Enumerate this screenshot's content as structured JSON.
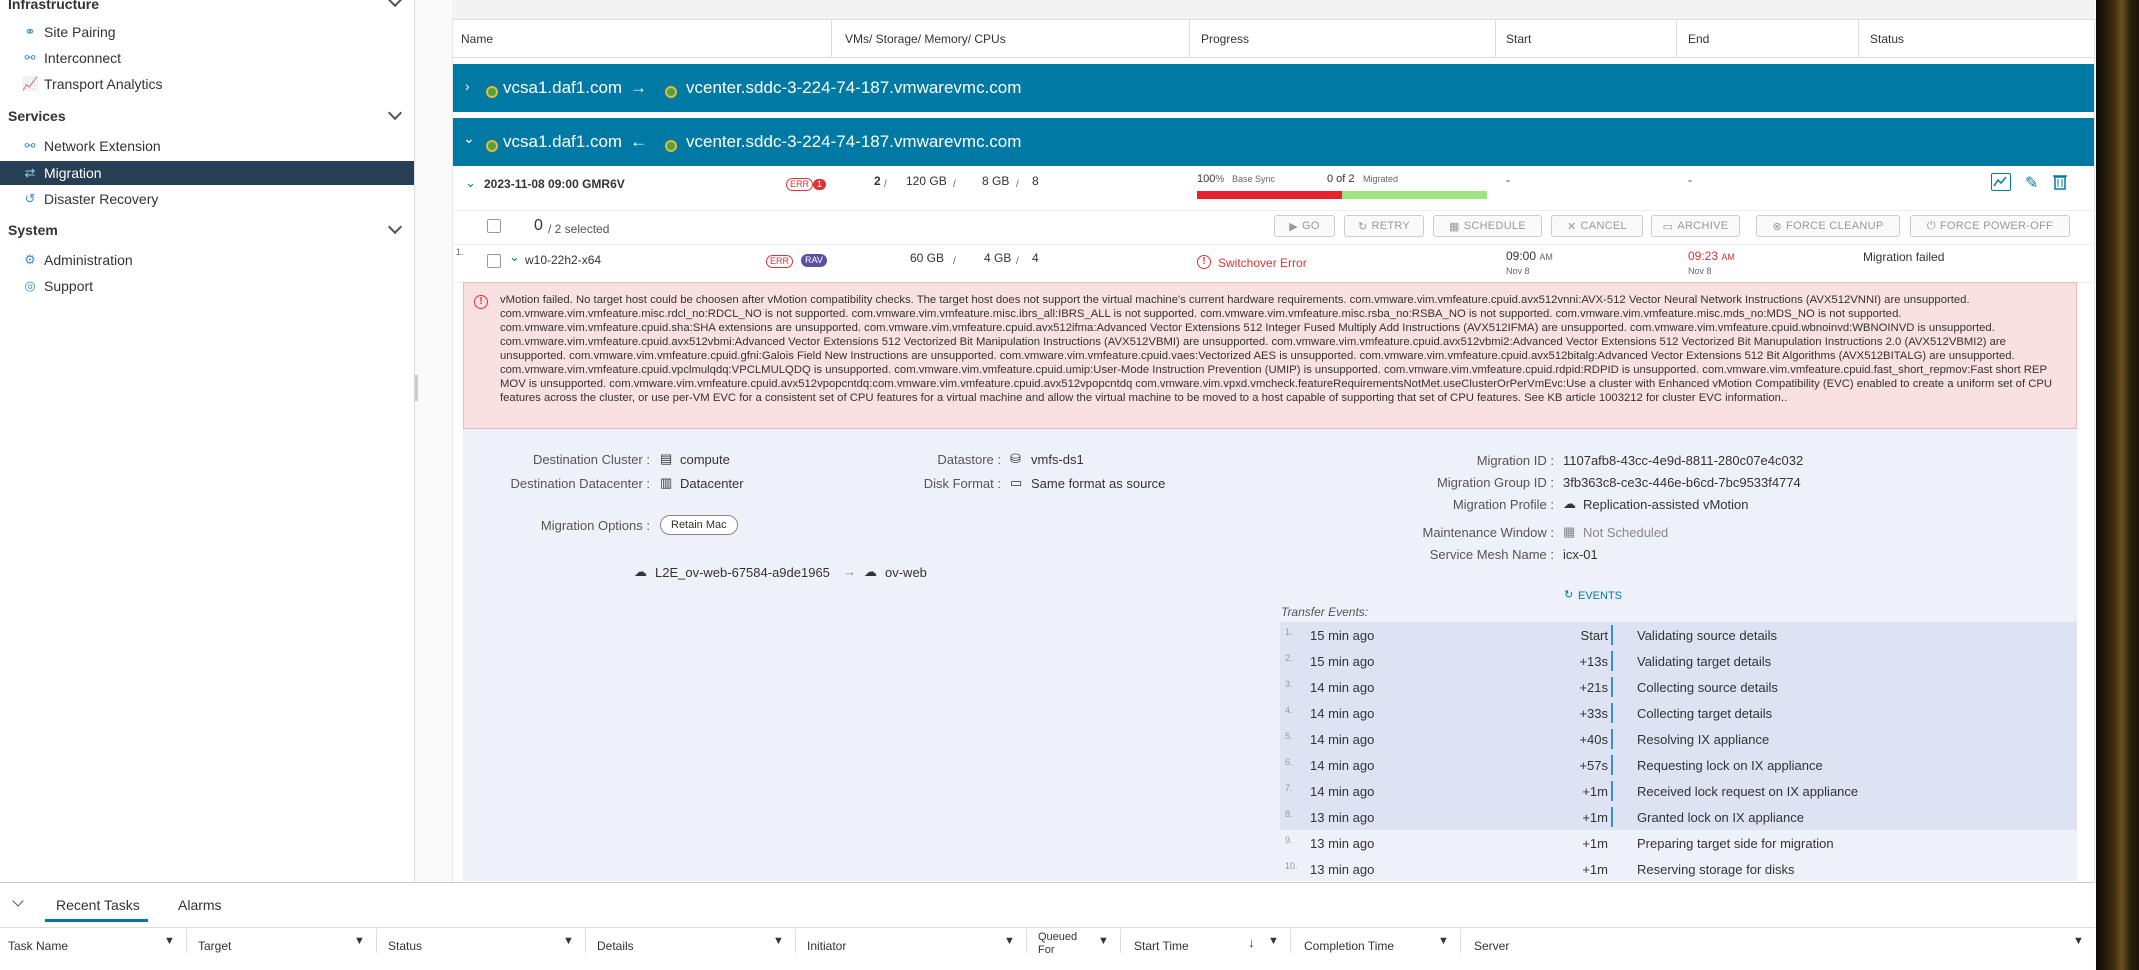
{
  "sidebar": {
    "sections": [
      {
        "title": "Infrastructure",
        "items": [
          {
            "label": "Site Pairing",
            "icon": "site-pairing-icon"
          },
          {
            "label": "Interconnect",
            "icon": "interconnect-icon"
          },
          {
            "label": "Transport Analytics",
            "icon": "analytics-icon"
          }
        ]
      },
      {
        "title": "Services",
        "items": [
          {
            "label": "Network Extension",
            "icon": "network-extension-icon"
          },
          {
            "label": "Migration",
            "icon": "migration-icon"
          },
          {
            "label": "Disaster Recovery",
            "icon": "disaster-recovery-icon"
          }
        ]
      },
      {
        "title": "System",
        "items": [
          {
            "label": "Administration",
            "icon": "administration-icon"
          },
          {
            "label": "Support",
            "icon": "support-icon"
          }
        ]
      }
    ]
  },
  "table": {
    "headers": [
      "Name",
      "VMs/ Storage/ Memory/ CPUs",
      "Progress",
      "Start",
      "End",
      "Status"
    ]
  },
  "pairs": [
    {
      "source": "vcsa1.daf1.com",
      "target": "vcenter.sddc-3-224-74-187.vmwarevmc.com",
      "expanded": false
    },
    {
      "source": "vcsa1.daf1.com",
      "target": "vcenter.sddc-3-224-74-187.vmwarevmc.com",
      "expanded": true
    }
  ],
  "group": {
    "name": "2023-11-08 09:00 GMR6V",
    "err": "ERR",
    "err_count": "1",
    "vms": "2",
    "storage": "120 GB",
    "memory": "8 GB",
    "cpus": "8",
    "progress_pct": "100",
    "progress_unit": "%",
    "progress_label": "Base Sync",
    "migrated_count": "0 of 2",
    "migrated_label": "Migrated",
    "start": "-",
    "end": "-"
  },
  "toolbar": {
    "selected_count": "0",
    "selected_text": "/ 2 selected",
    "go": "GO",
    "retry": "RETRY",
    "schedule": "SCHEDULE",
    "cancel": "CANCEL",
    "archive": "ARCHIVE",
    "force_cleanup": "FORCE CLEANUP",
    "force_poweroff": "FORCE POWER-OFF"
  },
  "vm": {
    "index": "1.",
    "name": "w10-22h2-x64",
    "err": "ERR",
    "rav": "RAV",
    "storage": "60 GB",
    "memory": "4 GB",
    "cpus": "4",
    "error_label": "Switchover Error",
    "start_time": "09:00",
    "start_ampm": "AM",
    "start_date": "Nov 8",
    "end_time": "09:23",
    "end_ampm": "AM",
    "end_date": "Nov 8",
    "status": "Migration failed"
  },
  "error_message": "vMotion failed. No target host could be choosen after vMotion compatibility checks. The target host does not support the virtual machine's current hardware requirements. com.vmware.vim.vmfeature.cpuid.avx512vnni:AVX-512 Vector Neural Network Instructions (AVX512VNNI) are unsupported. com.vmware.vim.vmfeature.misc.rdcl_no:RDCL_NO is not supported. com.vmware.vim.vmfeature.misc.ibrs_all:IBRS_ALL is not supported. com.vmware.vim.vmfeature.misc.rsba_no:RSBA_NO is not supported. com.vmware.vim.vmfeature.misc.mds_no:MDS_NO is not supported. com.vmware.vim.vmfeature.cpuid.sha:SHA extensions are unsupported. com.vmware.vim.vmfeature.cpuid.avx512ifma:Advanced Vector Extensions 512 Integer Fused Multiply Add Instructions (AVX512IFMA) are unsupported. com.vmware.vim.vmfeature.cpuid.wbnoinvd:WBNOINVD is unsupported. com.vmware.vim.vmfeature.cpuid.avx512vbmi:Advanced Vector Extensions 512 Vectorized Bit Manipulation Instructions (AVX512VBMI) are unsupported. com.vmware.vim.vmfeature.cpuid.avx512vbmi2:Advanced Vector Extensions 512 Vectorized Bit Manupulation Instructions 2.0 (AVX512VBMI2) are unsupported. com.vmware.vim.vmfeature.cpuid.gfni:Galois Field New Instructions are unsupported. com.vmware.vim.vmfeature.cpuid.vaes:Vectorized AES is unsupported. com.vmware.vim.vmfeature.cpuid.avx512bitalg:Advanced Vector Extensions 512 Bit Algorithms (AVX512BITALG) are unsupported. com.vmware.vim.vmfeature.cpuid.vpclmulqdq:VPCLMULQDQ is unsupported. com.vmware.vim.vmfeature.cpuid.umip:User-Mode Instruction Prevention (UMIP) is unsupported. com.vmware.vim.vmfeature.cpuid.rdpid:RDPID is unsupported. com.vmware.vim.vmfeature.cpuid.fast_short_repmov:Fast short REP MOV is unsupported. com.vmware.vim.vmfeature.cpuid.avx512vpopcntdq:com.vmware.vim.vmfeature.cpuid.avx512vpopcntdq com.vmware.vim.vpxd.vmcheck.featureRequirementsNotMet.useClusterOrPerVmEvc:Use a cluster with Enhanced vMotion Compatibility (EVC) enabled to create a uniform set of CPU features across the cluster, or use per-VM EVC for a consistent set of CPU features for a virtual machine and allow the virtual machine to be moved to a host capable of supporting that set of CPU features. See KB article 1003212 for cluster EVC information..",
  "details": {
    "dest_cluster_label": "Destination Cluster :",
    "dest_cluster": "compute",
    "dest_dc_label": "Destination Datacenter :",
    "dest_dc": "Datacenter",
    "datastore_label": "Datastore :",
    "datastore": "vmfs-ds1",
    "disk_format_label": "Disk Format :",
    "disk_format": "Same format as source",
    "migration_options_label": "Migration Options :",
    "retain_mac": "Retain Mac",
    "network_source": "L2E_ov-web-67584-a9de1965",
    "network_target": "ov-web",
    "migration_id_label": "Migration ID :",
    "migration_id": "1107afb8-43cc-4e9d-8811-280c07e4c032",
    "migration_group_id_label": "Migration Group ID :",
    "migration_group_id": "3fb363c8-ce3c-446e-b6cd-7bc9533f4774",
    "migration_profile_label": "Migration Profile :",
    "migration_profile": "Replication-assisted vMotion",
    "maintenance_window_label": "Maintenance Window :",
    "maintenance_window": "Not Scheduled",
    "service_mesh_label": "Service Mesh Name :",
    "service_mesh": "icx-01",
    "events_link": "EVENTS",
    "transfer_events_label": "Transfer Events:"
  },
  "events": [
    {
      "n": "1.",
      "ago": "15 min ago",
      "delta": "Start",
      "text": "Validating source details"
    },
    {
      "n": "2.",
      "ago": "15 min ago",
      "delta": "+13s",
      "text": "Validating target details"
    },
    {
      "n": "3.",
      "ago": "14 min ago",
      "delta": "+21s",
      "text": "Collecting source details"
    },
    {
      "n": "4.",
      "ago": "14 min ago",
      "delta": "+33s",
      "text": "Collecting target details"
    },
    {
      "n": "5.",
      "ago": "14 min ago",
      "delta": "+40s",
      "text": "Resolving IX appliance"
    },
    {
      "n": "6.",
      "ago": "14 min ago",
      "delta": "+57s",
      "text": "Requesting lock on IX appliance"
    },
    {
      "n": "7.",
      "ago": "14 min ago",
      "delta": "+1m",
      "text": "Received lock request on IX appliance"
    },
    {
      "n": "8.",
      "ago": "13 min ago",
      "delta": "+1m",
      "text": "Granted lock on IX appliance"
    },
    {
      "n": "9.",
      "ago": "13 min ago",
      "delta": "+1m",
      "text": "Preparing target side for migration"
    },
    {
      "n": "10.",
      "ago": "13 min ago",
      "delta": "+1m",
      "text": "Reserving storage for disks"
    }
  ],
  "bottom": {
    "tabs": [
      "Recent Tasks",
      "Alarms"
    ],
    "columns": [
      "Task Name",
      "Target",
      "Status",
      "Details",
      "Initiator",
      "Queued For",
      "Start Time",
      "Completion Time",
      "Server"
    ]
  },
  "colors": {
    "pair_bar": "#0079a4",
    "active_nav": "#263f54",
    "error_bg": "#fae1e1",
    "details_bg": "#eef1f9",
    "progress_red": "#e8212d",
    "progress_green": "#9de47f"
  }
}
